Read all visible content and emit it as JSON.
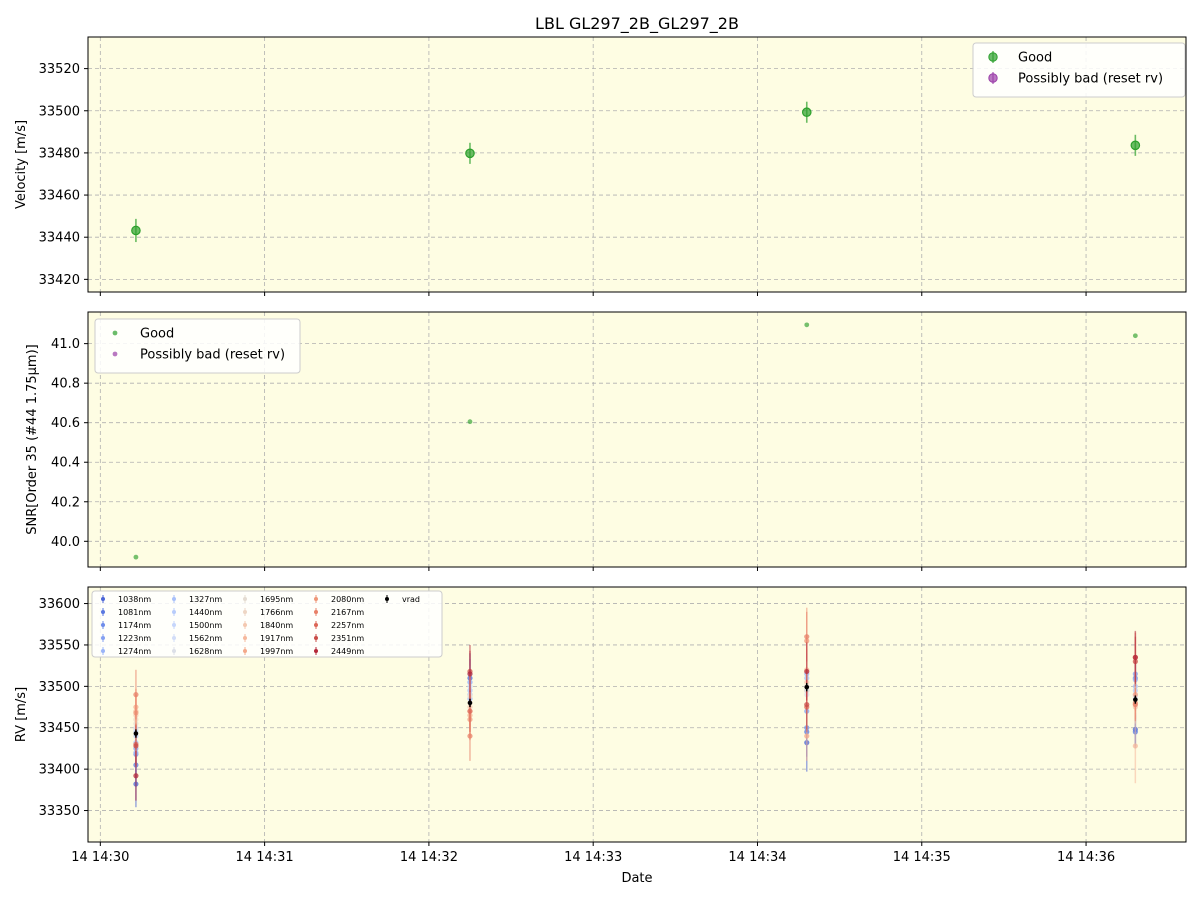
{
  "title": "LBL GL297_2B_GL297_2B",
  "xlabel": "Date",
  "x_ticks": [
    "14 14:30",
    "14 14:31",
    "14 14:32",
    "14 14:33",
    "14 14:34",
    "14 14:35",
    "14 14:36"
  ],
  "colors": {
    "bg": "#fefde3",
    "good": "#2ca02c",
    "bad": "#9b3fa8",
    "vrad": "#000000",
    "grid": "#b0b0b0"
  },
  "chart_data": [
    {
      "type": "scatter",
      "ylabel": "Velocity [m/s]",
      "ylim": [
        33414,
        33535
      ],
      "y_ticks": [
        33420,
        33440,
        33460,
        33480,
        33500,
        33520
      ],
      "legend_position": "top-right",
      "grid": true,
      "series": [
        {
          "name": "Good",
          "points": [
            {
              "t": "14:30:13",
              "y": 33443.2,
              "err": 5.5
            },
            {
              "t": "14:32:15",
              "y": 33479.8,
              "err": 5.0
            },
            {
              "t": "14:34:18",
              "y": 33499.3,
              "err": 5.0
            },
            {
              "t": "14:36:18",
              "y": 33483.6,
              "err": 5.0
            }
          ]
        },
        {
          "name": "Possibly bad (reset rv)",
          "points": []
        }
      ]
    },
    {
      "type": "scatter",
      "ylabel": "SNR[Order 35 (#44 1.75μm)]",
      "ylim": [
        39.87,
        41.16
      ],
      "y_ticks": [
        40.0,
        40.2,
        40.4,
        40.6,
        40.8,
        41.0
      ],
      "legend_position": "top-left",
      "grid": true,
      "series": [
        {
          "name": "Good",
          "points": [
            {
              "t": "14:30:13",
              "y": 39.92
            },
            {
              "t": "14:32:15",
              "y": 40.605
            },
            {
              "t": "14:34:18",
              "y": 41.095
            },
            {
              "t": "14:36:18",
              "y": 41.04
            }
          ]
        },
        {
          "name": "Possibly bad (reset rv)",
          "points": []
        }
      ]
    },
    {
      "type": "scatter",
      "ylabel": "RV [m/s]",
      "ylim": [
        33312,
        33620
      ],
      "y_ticks": [
        33350,
        33400,
        33450,
        33500,
        33550,
        33600
      ],
      "legend_position": "top-left",
      "grid": true,
      "times": [
        "14:30:13",
        "14:32:15",
        "14:34:18",
        "14:36:18"
      ],
      "series": [
        {
          "name": "1038nm",
          "color": "#4a64d6",
          "values": [
            33382,
            33510,
            33432,
            33448
          ],
          "err": [
            28,
            30,
            35,
            20
          ]
        },
        {
          "name": "1081nm",
          "color": "#5a78e0",
          "values": [
            33405,
            33505,
            33445,
            33445
          ],
          "err": [
            25,
            28,
            30,
            20
          ]
        },
        {
          "name": "1174nm",
          "color": "#6e8cea",
          "values": [
            33418,
            33495,
            33450,
            33510
          ],
          "err": [
            22,
            25,
            28,
            20
          ]
        },
        {
          "name": "1223nm",
          "color": "#84a0f2",
          "values": [
            33425,
            33490,
            33470,
            33515
          ],
          "err": [
            20,
            22,
            25,
            18
          ]
        },
        {
          "name": "1274nm",
          "color": "#9ab4f8",
          "values": [
            33420,
            33485,
            33515,
            33508
          ],
          "err": [
            20,
            22,
            25,
            18
          ]
        },
        {
          "name": "1327nm",
          "color": "#a8c0fa",
          "values": [
            33432,
            33515,
            33510,
            33500
          ],
          "err": [
            18,
            20,
            22,
            18
          ]
        },
        {
          "name": "1440nm",
          "color": "#b8ccfb",
          "values": [
            33440,
            33505,
            33500,
            33495
          ],
          "err": [
            18,
            20,
            22,
            18
          ]
        },
        {
          "name": "1500nm",
          "color": "#c6d6fb",
          "values": [
            33445,
            33500,
            33495,
            33490
          ],
          "err": [
            18,
            20,
            22,
            18
          ]
        },
        {
          "name": "1562nm",
          "color": "#d2ddf8",
          "values": [
            33448,
            33495,
            33495,
            33488
          ],
          "err": [
            18,
            20,
            22,
            18
          ]
        },
        {
          "name": "1628nm",
          "color": "#dcdfe8",
          "values": [
            33450,
            33490,
            33490,
            33485
          ],
          "err": [
            18,
            20,
            22,
            18
          ]
        },
        {
          "name": "1695nm",
          "color": "#e4dcd2",
          "values": [
            33455,
            33488,
            33495,
            33480
          ],
          "err": [
            18,
            20,
            22,
            18
          ]
        },
        {
          "name": "1766nm",
          "color": "#eed6c4",
          "values": [
            33460,
            33480,
            33500,
            33478
          ],
          "err": [
            18,
            20,
            22,
            18
          ]
        },
        {
          "name": "1840nm",
          "color": "#f4c8b0",
          "values": [
            33465,
            33475,
            33505,
            33475
          ],
          "err": [
            20,
            22,
            25,
            20
          ]
        },
        {
          "name": "1917nm",
          "color": "#f6b89c",
          "values": [
            33470,
            33470,
            33520,
            33428
          ],
          "err": [
            20,
            22,
            25,
            45
          ]
        },
        {
          "name": "1997nm",
          "color": "#f4a88a",
          "values": [
            33475,
            33465,
            33440,
            33490
          ],
          "err": [
            22,
            25,
            30,
            20
          ]
        },
        {
          "name": "2080nm",
          "color": "#ef9678",
          "values": [
            33468,
            33460,
            33555,
            33480
          ],
          "err": [
            22,
            25,
            40,
            20
          ]
        },
        {
          "name": "2167nm",
          "color": "#e88068",
          "values": [
            33490,
            33440,
            33560,
            33478
          ],
          "err": [
            30,
            30,
            30,
            20
          ]
        },
        {
          "name": "2257nm",
          "color": "#dc6656",
          "values": [
            33430,
            33470,
            33475,
            33535
          ],
          "err": [
            25,
            25,
            30,
            30
          ]
        },
        {
          "name": "2351nm",
          "color": "#c94c48",
          "values": [
            33428,
            33518,
            33478,
            33530
          ],
          "err": [
            25,
            25,
            30,
            30
          ]
        },
        {
          "name": "2449nm",
          "color": "#b4283a",
          "values": [
            33392,
            33515,
            33518,
            33535
          ],
          "err": [
            30,
            35,
            35,
            32
          ]
        },
        {
          "name": "vrad",
          "color": "#000000",
          "values": [
            33443,
            33480,
            33499,
            33484
          ],
          "err": [
            5,
            5,
            5,
            5
          ]
        }
      ]
    }
  ]
}
